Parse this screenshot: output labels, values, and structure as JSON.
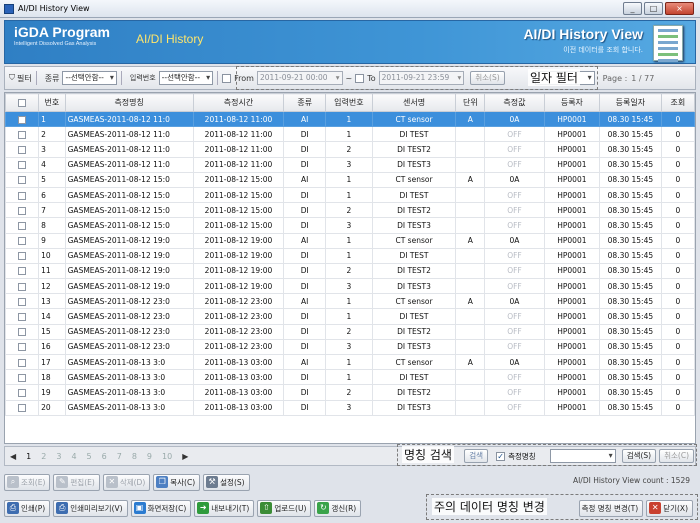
{
  "window": {
    "title": "AI/DI History View",
    "controls": [
      "_",
      "□",
      "×"
    ]
  },
  "banner": {
    "brand": "iGDA Program",
    "brand_sub": "Intelligent Dissolved Gas Analysis",
    "subtitle": "AI/DI History",
    "title": "AI/DI History View",
    "description": "이전 데이터를 조회 합니다."
  },
  "filter": {
    "filter_label": "필터",
    "type_label": "종류",
    "type_value": "--선택안함--",
    "input_label": "입력번호",
    "input_value": "--선택안함--",
    "from_label": "From",
    "from_value": "2011-09-21 00:00",
    "tilde": "~",
    "to_label": "To",
    "to_value": "2011-09-21 23:59",
    "cancel_label": "취소(S)",
    "page_label": "Page :",
    "page_value": "1 / 77"
  },
  "callouts": {
    "date_filter": "일자 필터",
    "name_search": "명칭 검색",
    "note_change": "주의 데이터 명칭 변경"
  },
  "table": {
    "headers": [
      "",
      "번호",
      "측정명칭",
      "측정시간",
      "종류",
      "입력번호",
      "센서명",
      "단위",
      "측정값",
      "등록자",
      "등록일자",
      "조회"
    ],
    "rows": [
      [
        "1",
        "GASMEAS-2011-08-12 11:0",
        "2011-08-12 11:00",
        "AI",
        "1",
        "CT sensor",
        "A",
        "0A",
        "HP0001",
        "08.30 15:45",
        "0"
      ],
      [
        "2",
        "GASMEAS-2011-08-12 11:0",
        "2011-08-12 11:00",
        "DI",
        "1",
        "DI TEST",
        "",
        "OFF",
        "HP0001",
        "08.30 15:45",
        "0"
      ],
      [
        "3",
        "GASMEAS-2011-08-12 11:0",
        "2011-08-12 11:00",
        "DI",
        "2",
        "DI TEST2",
        "",
        "OFF",
        "HP0001",
        "08.30 15:45",
        "0"
      ],
      [
        "4",
        "GASMEAS-2011-08-12 11:0",
        "2011-08-12 11:00",
        "DI",
        "3",
        "DI TEST3",
        "",
        "OFF",
        "HP0001",
        "08.30 15:45",
        "0"
      ],
      [
        "5",
        "GASMEAS-2011-08-12 15:0",
        "2011-08-12 15:00",
        "AI",
        "1",
        "CT sensor",
        "A",
        "0A",
        "HP0001",
        "08.30 15:45",
        "0"
      ],
      [
        "6",
        "GASMEAS-2011-08-12 15:0",
        "2011-08-12 15:00",
        "DI",
        "1",
        "DI TEST",
        "",
        "OFF",
        "HP0001",
        "08.30 15:45",
        "0"
      ],
      [
        "7",
        "GASMEAS-2011-08-12 15:0",
        "2011-08-12 15:00",
        "DI",
        "2",
        "DI TEST2",
        "",
        "OFF",
        "HP0001",
        "08.30 15:45",
        "0"
      ],
      [
        "8",
        "GASMEAS-2011-08-12 15:0",
        "2011-08-12 15:00",
        "DI",
        "3",
        "DI TEST3",
        "",
        "OFF",
        "HP0001",
        "08.30 15:45",
        "0"
      ],
      [
        "9",
        "GASMEAS-2011-08-12 19:0",
        "2011-08-12 19:00",
        "AI",
        "1",
        "CT sensor",
        "A",
        "0A",
        "HP0001",
        "08.30 15:45",
        "0"
      ],
      [
        "10",
        "GASMEAS-2011-08-12 19:0",
        "2011-08-12 19:00",
        "DI",
        "1",
        "DI TEST",
        "",
        "OFF",
        "HP0001",
        "08.30 15:45",
        "0"
      ],
      [
        "11",
        "GASMEAS-2011-08-12 19:0",
        "2011-08-12 19:00",
        "DI",
        "2",
        "DI TEST2",
        "",
        "OFF",
        "HP0001",
        "08.30 15:45",
        "0"
      ],
      [
        "12",
        "GASMEAS-2011-08-12 19:0",
        "2011-08-12 19:00",
        "DI",
        "3",
        "DI TEST3",
        "",
        "OFF",
        "HP0001",
        "08.30 15:45",
        "0"
      ],
      [
        "13",
        "GASMEAS-2011-08-12 23:0",
        "2011-08-12 23:00",
        "AI",
        "1",
        "CT sensor",
        "A",
        "0A",
        "HP0001",
        "08.30 15:45",
        "0"
      ],
      [
        "14",
        "GASMEAS-2011-08-12 23:0",
        "2011-08-12 23:00",
        "DI",
        "1",
        "DI TEST",
        "",
        "OFF",
        "HP0001",
        "08.30 15:45",
        "0"
      ],
      [
        "15",
        "GASMEAS-2011-08-12 23:0",
        "2011-08-12 23:00",
        "DI",
        "2",
        "DI TEST2",
        "",
        "OFF",
        "HP0001",
        "08.30 15:45",
        "0"
      ],
      [
        "16",
        "GASMEAS-2011-08-12 23:0",
        "2011-08-12 23:00",
        "DI",
        "3",
        "DI TEST3",
        "",
        "OFF",
        "HP0001",
        "08.30 15:45",
        "0"
      ],
      [
        "17",
        "GASMEAS-2011-08-13 3:0",
        "2011-08-13 03:00",
        "AI",
        "1",
        "CT sensor",
        "A",
        "0A",
        "HP0001",
        "08.30 15:45",
        "0"
      ],
      [
        "18",
        "GASMEAS-2011-08-13 3:0",
        "2011-08-13 03:00",
        "DI",
        "1",
        "DI TEST",
        "",
        "OFF",
        "HP0001",
        "08.30 15:45",
        "0"
      ],
      [
        "19",
        "GASMEAS-2011-08-13 3:0",
        "2011-08-13 03:00",
        "DI",
        "2",
        "DI TEST2",
        "",
        "OFF",
        "HP0001",
        "08.30 15:45",
        "0"
      ],
      [
        "20",
        "GASMEAS-2011-08-13 3:0",
        "2011-08-13 03:00",
        "DI",
        "3",
        "DI TEST3",
        "",
        "OFF",
        "HP0001",
        "08.30 15:45",
        "0"
      ]
    ]
  },
  "pager": {
    "prev": "◀",
    "pages": [
      "1",
      "2",
      "3",
      "4",
      "5",
      "6",
      "7",
      "8",
      "9",
      "10"
    ],
    "next": "▶"
  },
  "search": {
    "name_label": "측정명칭",
    "search_btn": "검색(S)",
    "cancel_btn": "취소(C)",
    "hidden_btn": "검색"
  },
  "actions1": {
    "view": "조회(E)",
    "edit": "편집(E)",
    "delete": "삭제(D)",
    "copy": "복사(C)",
    "settings": "설정(S)"
  },
  "status": {
    "text": "AI/DI History View count : 1529"
  },
  "actions2": {
    "print": "인쇄(P)",
    "preview": "인쇄미리보기(V)",
    "screen_save": "화면저장(C)",
    "export": "내보내기(T)",
    "upload": "업로드(U)",
    "refresh": "갱신(R)",
    "rename": "측정 명칭 변경(T)",
    "close": "닫기(X)"
  }
}
